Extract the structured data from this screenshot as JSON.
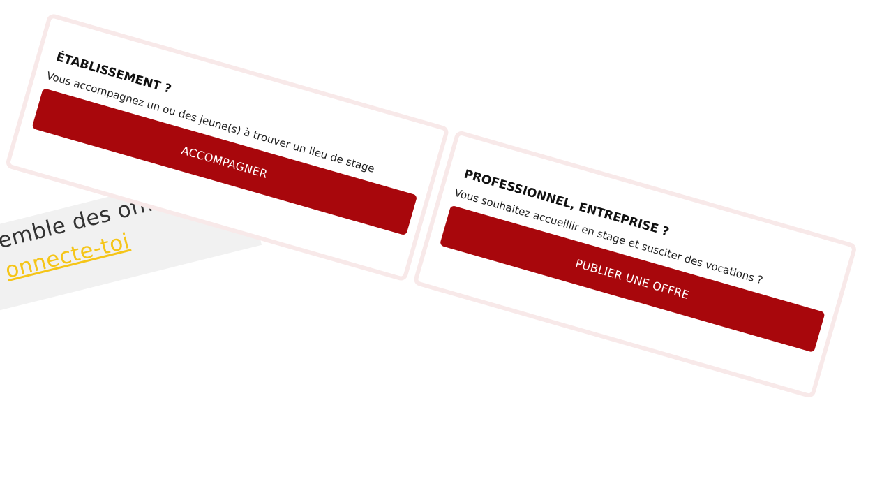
{
  "banner": {
    "text": "emble des offres,",
    "link": "onnecte-toi"
  },
  "cards": [
    {
      "title": "ÉTABLISSEMENT ?",
      "description": "Vous accompagnez un ou des jeune(s) à trouver un lieu de stage",
      "button_label": "ACCOMPAGNER"
    },
    {
      "title": "PROFESSIONNEL, ENTREPRISE ?",
      "description": "Vous souhaitez accueillir en stage et susciter des vocations ?",
      "button_label": "PUBLIER UNE OFFRE"
    }
  ],
  "colors": {
    "button": "#a8070c",
    "card_border": "#f8e9e9",
    "link": "#f5c518",
    "banner_bg": "#f1f1f1"
  }
}
